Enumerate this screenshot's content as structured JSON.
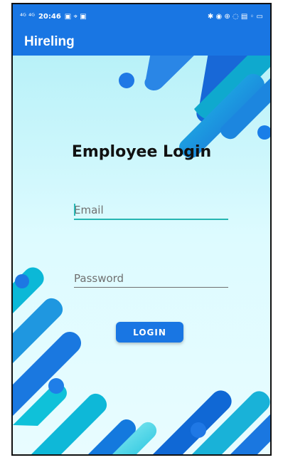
{
  "status_bar": {
    "left_text": "⁴ᴳ ⁴ᴳ",
    "time": "20:46",
    "right_text": "✱ ◉ ⊕ ◌ ▤ ◦ ▭"
  },
  "app_bar": {
    "title": "Hireling"
  },
  "login": {
    "title": "Employee Login",
    "email_placeholder": "Email",
    "password_placeholder": "Password",
    "button_label": "LOGIN"
  },
  "colors": {
    "primary": "#1976e3",
    "background": "#ddfbff",
    "accent": "#26b6b2"
  },
  "icons": {
    "status": [
      "signal-icon",
      "wifi-icon",
      "battery-icon"
    ]
  }
}
